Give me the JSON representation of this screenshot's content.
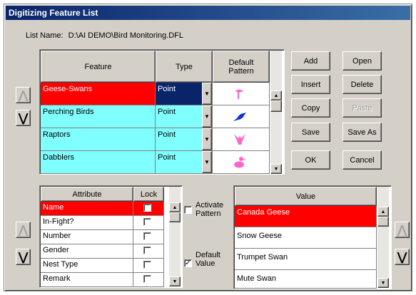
{
  "window": {
    "title": "Digitizing Feature List"
  },
  "list_name": {
    "label": "List Name:",
    "value": "D:\\AI DEMO\\Bird Monitoring.DFL"
  },
  "feature_table": {
    "headers": {
      "feature": "Feature",
      "type": "Type",
      "pattern": "Default Pattern"
    },
    "rows": [
      {
        "feature": "Geese-Swans",
        "type": "Point",
        "pattern_icon": "goose-pattern-icon",
        "pattern_color": "#ff66cc"
      },
      {
        "feature": "Perching Birds",
        "type": "Point",
        "pattern_icon": "songbird-pattern-icon",
        "pattern_color": "#1030d0"
      },
      {
        "feature": "Raptors",
        "type": "Point",
        "pattern_icon": "raptor-pattern-icon",
        "pattern_color": "#ff66cc"
      },
      {
        "feature": "Dabblers",
        "type": "Point",
        "pattern_icon": "duck-pattern-icon",
        "pattern_color": "#ff66cc"
      }
    ]
  },
  "buttons": {
    "add": "Add",
    "open": "Open",
    "insert": "Insert",
    "delete": "Delete",
    "copy": "Copy",
    "paste": "Paste",
    "save": "Save",
    "save_as": "Save As",
    "ok": "OK",
    "cancel": "Cancel"
  },
  "attribute_table": {
    "headers": {
      "attribute": "Attribute",
      "lock": "Lock"
    },
    "rows": [
      {
        "name": "Name",
        "locked": false
      },
      {
        "name": "In-Fight?",
        "locked": false
      },
      {
        "name": "Number",
        "locked": false
      },
      {
        "name": "Gender",
        "locked": false
      },
      {
        "name": "Nest Type",
        "locked": false
      },
      {
        "name": "Remark",
        "locked": false
      }
    ]
  },
  "options": {
    "activate_pattern": {
      "label": "Activate Pattern",
      "checked": false
    },
    "default_value": {
      "label": "Default Value",
      "checked": true
    }
  },
  "value_table": {
    "header": "Value",
    "rows": [
      "Canada Geese",
      "Snow Geese",
      "Trumpet Swan",
      "Mute Swan"
    ]
  },
  "colors": {
    "selected_red": "#ff0000",
    "feature_cyan": "#80ffff",
    "navy": "#0a246a"
  }
}
